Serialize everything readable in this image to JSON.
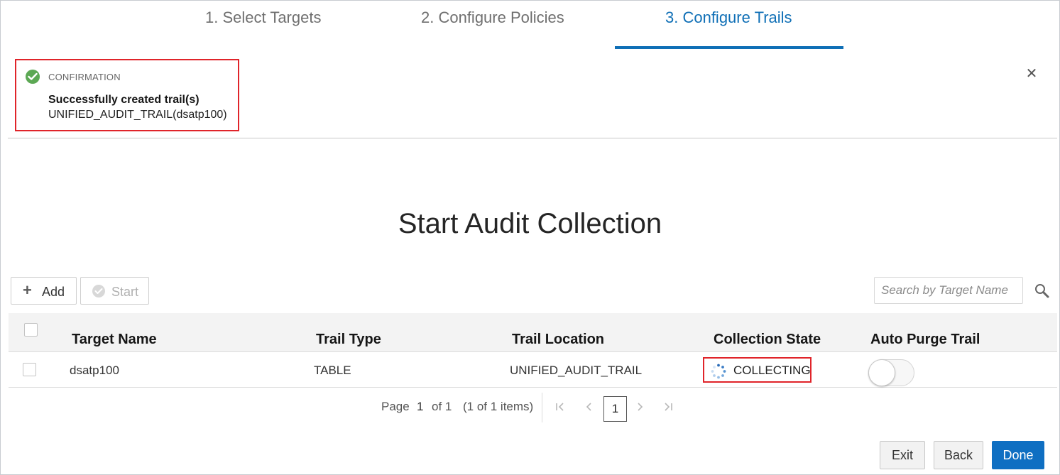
{
  "wizard": {
    "steps": [
      {
        "label": "1. Select Targets"
      },
      {
        "label": "2. Configure Policies"
      },
      {
        "label": "3. Configure Trails"
      }
    ],
    "active_step": 3
  },
  "confirmation": {
    "heading": "CONFIRMATION",
    "message": "Successfully created trail(s)",
    "detail": "UNIFIED_AUDIT_TRAIL(dsatp100)",
    "close_icon": "close-icon"
  },
  "page": {
    "title": "Start Audit Collection"
  },
  "toolbar": {
    "add_label": "Add",
    "start_label": "Start",
    "search_placeholder": "Search by Target Name"
  },
  "table": {
    "columns": [
      "Target Name",
      "Trail Type",
      "Trail Location",
      "Collection State",
      "Auto Purge Trail"
    ],
    "rows": [
      {
        "target_name": "dsatp100",
        "trail_type": "TABLE",
        "trail_location": "UNIFIED_AUDIT_TRAIL",
        "collection_state": "COLLECTING",
        "auto_purge": false
      }
    ]
  },
  "pagination": {
    "page_label": "Page",
    "page_number": "1",
    "of_label": "of 1",
    "items_label": "(1 of 1 items)",
    "current": "1"
  },
  "footer": {
    "exit_label": "Exit",
    "back_label": "Back",
    "done_label": "Done"
  },
  "colors": {
    "accent": "#0f6fb6",
    "primary_button": "#0f6fc2",
    "highlight_border": "#e0242a",
    "success": "#5ca854"
  }
}
